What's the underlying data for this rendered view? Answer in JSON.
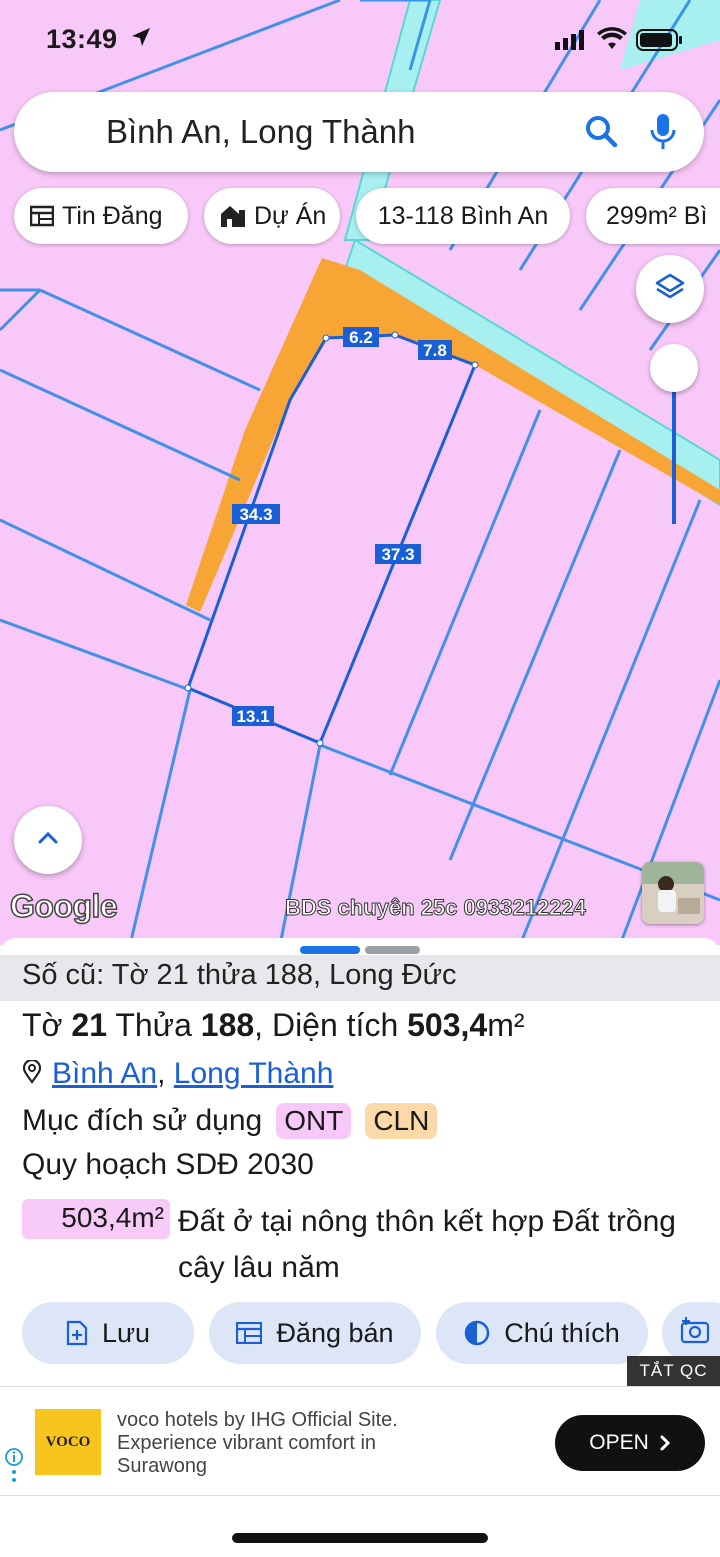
{
  "status_bar": {
    "time": "13:49"
  },
  "search": {
    "query": "Bình An, Long Thành"
  },
  "chips": [
    {
      "label": "Tin Đăng",
      "icon": "list-icon"
    },
    {
      "label": "Dự Án",
      "icon": "building-icon"
    },
    {
      "label": "13-118 Bình An"
    },
    {
      "label": "299m² Bì"
    }
  ],
  "map": {
    "edge_labels": [
      "6.2",
      "7.8",
      "34.3",
      "37.3",
      "13.1"
    ],
    "google_label": "Google",
    "watermark": "BDS chuyên 25c 0933212224",
    "colors": {
      "land": "#f8c8f8",
      "parcel_line": "#2f8be6",
      "orange_strip": "#f7a535",
      "road": "#a8f0f0",
      "highlight_line": "#1a5fd6"
    }
  },
  "sheet": {
    "old_info": "Số cũ: Tờ 21 thửa 188, Long Đức",
    "to_label": "Tờ",
    "to_num": "21",
    "thua_label": "Thửa",
    "thua_num": "188",
    "area_label": ", Diện tích",
    "area_value": "503,4",
    "area_unit": "m²",
    "location_1": "Bình An",
    "location_sep": ",",
    "location_2": "Long Thành",
    "purpose_label": "Mục đích sử dụng",
    "tag_1": "ONT",
    "tag_2": "CLN",
    "plan_label": "Quy hoạch SDĐ 2030",
    "plan_area": "503,4m²",
    "plan_desc": "Đất ở tại nông thôn kết hợp Đất trồng cây lâu năm"
  },
  "actions": [
    {
      "label": "Lưu",
      "icon": "save-add-icon"
    },
    {
      "label": "Đăng bán",
      "icon": "post-icon"
    },
    {
      "label": "Chú thích",
      "icon": "legend-icon"
    }
  ],
  "ad": {
    "close_label": "TẮT QC",
    "logo_text": "VOCO",
    "text": "voco hotels by IHG Official Site. Experience vibrant comfort in Surawong",
    "cta": "OPEN"
  }
}
